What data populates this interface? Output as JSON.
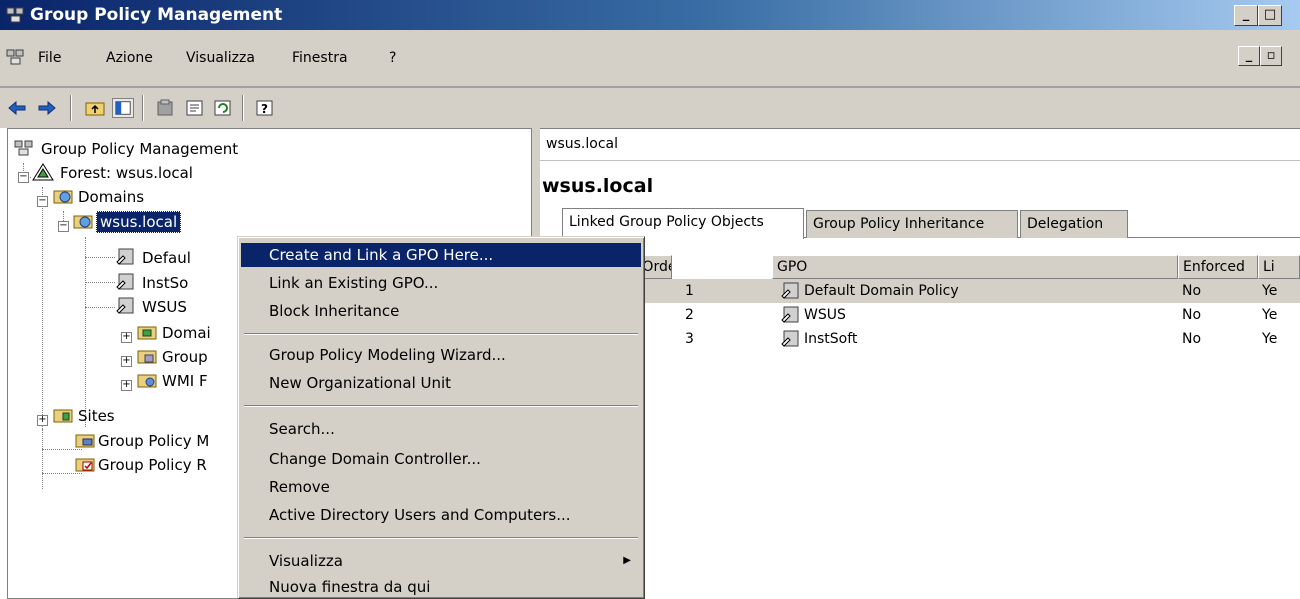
{
  "window": {
    "title": "Group Policy Management"
  },
  "menu": {
    "items": [
      "File",
      "Azione",
      "Visualizza",
      "Finestra",
      "?"
    ]
  },
  "tree": {
    "root": "Group Policy Management",
    "forest": "Forest: wsus.local",
    "domains": "Domains",
    "domain": "wsus.local",
    "children": [
      "Defaul",
      "InstSo",
      "WSUS",
      "Domai",
      "Group",
      "WMI F"
    ],
    "sites": "Sites",
    "gp_m": "Group Policy M",
    "gp_r": "Group Policy R"
  },
  "right": {
    "breadcrumb": "wsus.local",
    "heading": "wsus.local",
    "tabs": [
      "Linked Group Policy Objects",
      "Group Policy Inheritance",
      "Delegation"
    ],
    "columns": [
      "nk Order",
      "GPO",
      "Enforced",
      "Li"
    ],
    "rows": [
      {
        "order": "1",
        "gpo": "Default Domain Policy",
        "enforced": "No",
        "link": "Ye"
      },
      {
        "order": "2",
        "gpo": "WSUS",
        "enforced": "No",
        "link": "Ye"
      },
      {
        "order": "3",
        "gpo": "InstSoft",
        "enforced": "No",
        "link": "Ye"
      }
    ]
  },
  "context_menu": {
    "items": [
      "Create and Link a GPO Here...",
      "Link an Existing GPO...",
      "Block Inheritance",
      "Group Policy Modeling Wizard...",
      "New Organizational Unit",
      "Search...",
      "Change Domain Controller...",
      "Remove",
      "Active Directory Users and Computers...",
      "Visualizza",
      "Nuova finestra da qui"
    ],
    "highlighted_index": 0
  },
  "colors": {
    "titlebar": "#0a246a",
    "highlight": "#0a246a",
    "chrome": "#d4d0c8"
  },
  "icons": [
    "gpm-icon",
    "forest-icon",
    "domains-icon",
    "gpo-link-icon",
    "ou-icon",
    "folder-icon",
    "back-arrow-icon",
    "forward-arrow-icon",
    "up-folder-icon",
    "show-hide-tree-icon",
    "delete-icon",
    "properties-icon",
    "refresh-icon",
    "help-icon",
    "submenu-arrow-icon"
  ]
}
